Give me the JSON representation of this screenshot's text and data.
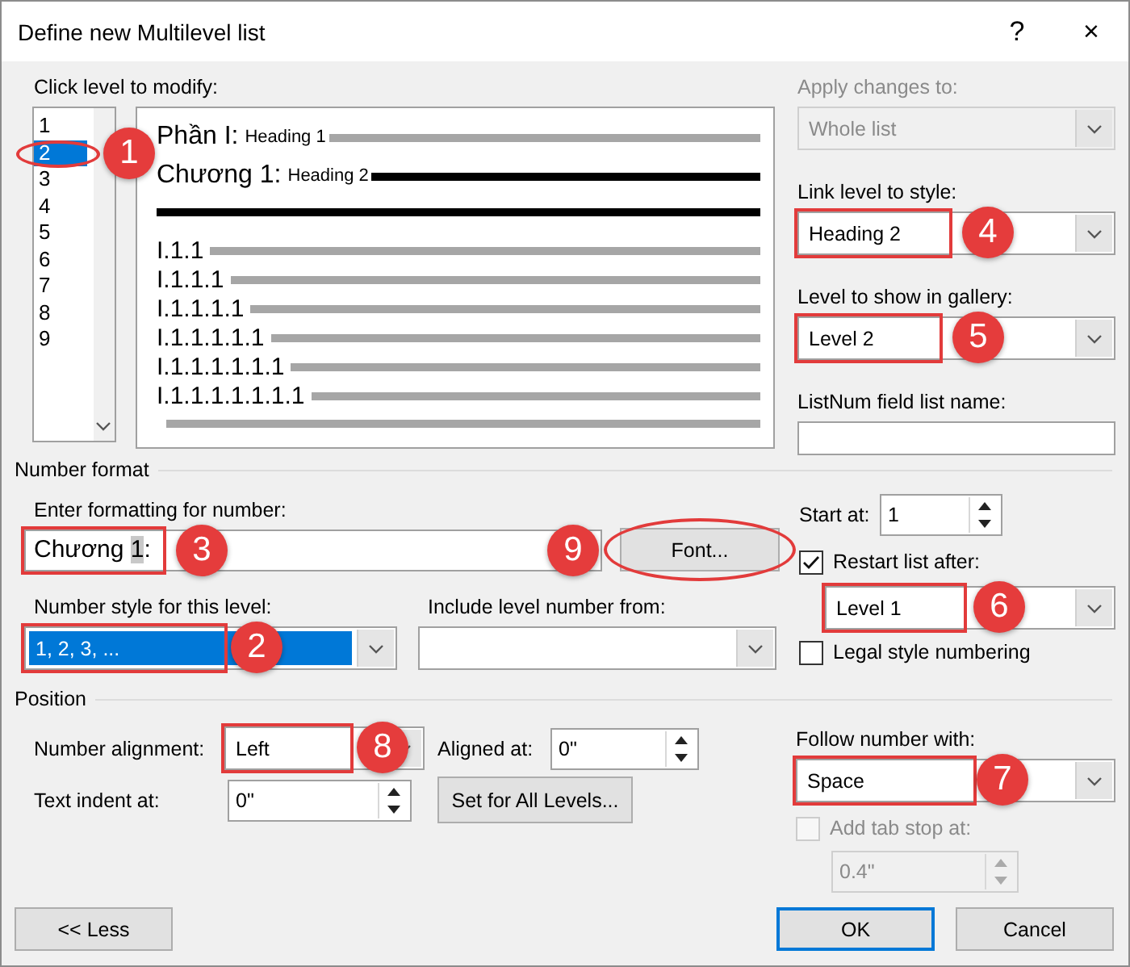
{
  "window": {
    "title": "Define new Multilevel list",
    "help": "?",
    "close": "×"
  },
  "level_list": {
    "label": "Click level to modify:",
    "items": [
      {
        "label": "1",
        "selected": false
      },
      {
        "label": "2",
        "selected": true,
        "callout": {
          "number": "1",
          "kind": "ellipse"
        }
      },
      {
        "label": "3",
        "selected": false
      },
      {
        "label": "4",
        "selected": false
      },
      {
        "label": "5",
        "selected": false
      },
      {
        "label": "6",
        "selected": false
      },
      {
        "label": "7",
        "selected": false
      },
      {
        "label": "8",
        "selected": false
      },
      {
        "label": "9",
        "selected": false
      }
    ]
  },
  "preview": {
    "rows": [
      {
        "number": "Phần I:",
        "style": "Heading 1",
        "selected": false
      },
      {
        "number": "Chương 1:",
        "style": "Heading 2",
        "selected": true
      },
      {
        "number": "I.1.1",
        "selected": false
      },
      {
        "number": "I.1.1.1",
        "selected": false
      },
      {
        "number": "I.1.1.1.1",
        "selected": false
      },
      {
        "number": "I.1.1.1.1.1",
        "selected": false
      },
      {
        "number": "I.1.1.1.1.1.1",
        "selected": false
      },
      {
        "number": "I.1.1.1.1.1.1.1",
        "selected": false
      }
    ]
  },
  "apply_changes": {
    "label": "Apply changes to:",
    "value": "Whole list",
    "disabled": true
  },
  "link_level": {
    "label": "Link level to style:",
    "value": "Heading 2",
    "callout": {
      "number": "4",
      "kind": "box"
    }
  },
  "gallery_level": {
    "label": "Level to show in gallery:",
    "value": "Level 2",
    "callout": {
      "number": "5",
      "kind": "box"
    }
  },
  "listnum": {
    "label": "ListNum field list name:"
  },
  "number_format": {
    "title": "Number format",
    "format_field": {
      "label": "Enter formatting for number:",
      "prefix": "Chương ",
      "number": "1",
      "suffix": ":",
      "callout": {
        "number": "3",
        "kind": "box"
      }
    },
    "font_button": {
      "label": "Font...",
      "callout": {
        "number": "9",
        "kind": "ellipse"
      }
    },
    "number_style": {
      "label": "Number style for this level:",
      "value": "1, 2, 3, ...",
      "callout": {
        "number": "2",
        "kind": "box"
      }
    },
    "include_level": {
      "label": "Include level number from:"
    },
    "start_at": {
      "label": "Start at:",
      "value": "1"
    },
    "restart": {
      "label": "Restart list after:",
      "checked": true
    },
    "restart_level": {
      "value": "Level 1",
      "callout": {
        "number": "6",
        "kind": "box"
      }
    },
    "legal": {
      "label": "Legal style numbering",
      "checked": false
    }
  },
  "position": {
    "title": "Position",
    "number_alignment": {
      "label": "Number alignment:",
      "value": "Left",
      "callout": {
        "number": "8",
        "kind": "box"
      }
    },
    "aligned_at": {
      "label": "Aligned at:",
      "value": "0\""
    },
    "text_indent": {
      "label": "Text indent at:",
      "value": "0\""
    },
    "set_all_button": {
      "label": "Set for All Levels..."
    },
    "follow": {
      "label": "Follow number with:",
      "value": "Space",
      "callout": {
        "number": "7",
        "kind": "box"
      }
    },
    "tab_stop": {
      "label": "Add tab stop at:",
      "checked": false,
      "disabled": true,
      "value": "0.4\""
    }
  },
  "buttons": [
    {
      "label": "<< Less",
      "default": false
    },
    {
      "label": "OK",
      "default": true
    },
    {
      "label": "Cancel",
      "default": false
    }
  ]
}
